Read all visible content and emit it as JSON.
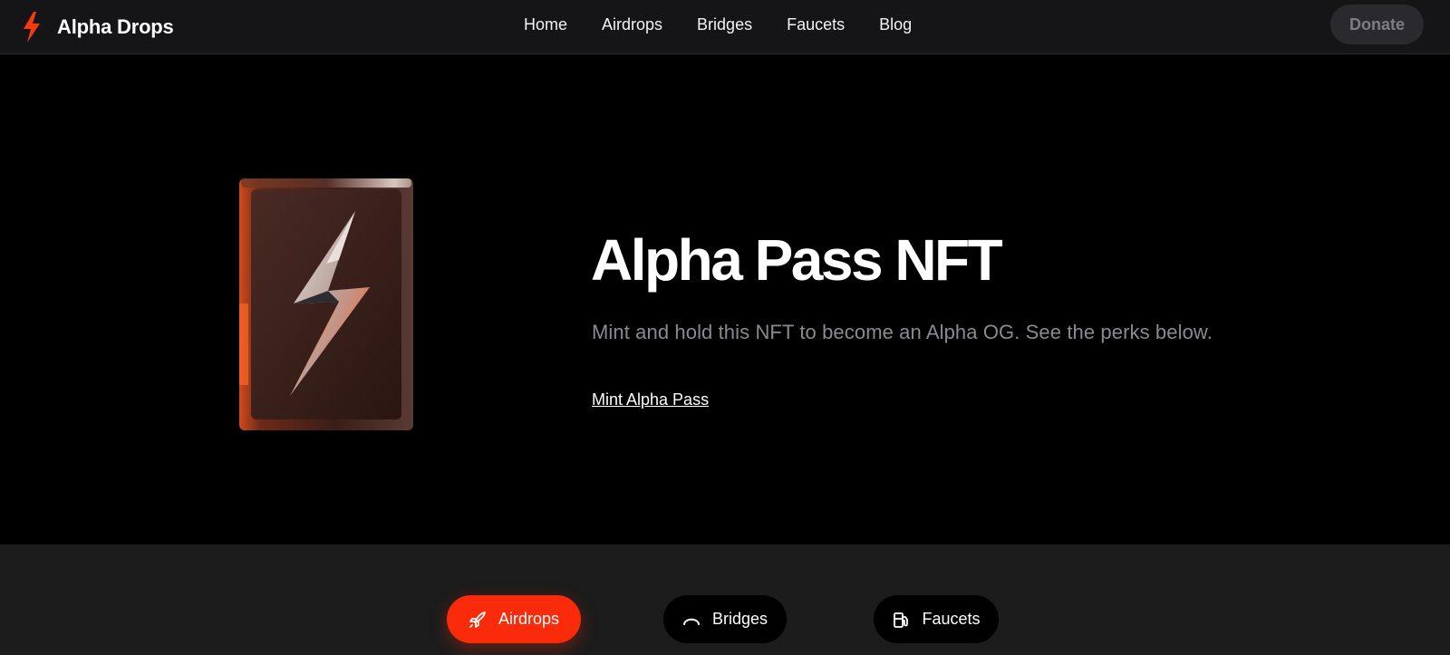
{
  "header": {
    "brand_name": "Alpha Drops",
    "nav": [
      "Home",
      "Airdrops",
      "Bridges",
      "Faucets",
      "Blog"
    ],
    "donate_label": "Donate"
  },
  "hero": {
    "title": "Alpha Pass NFT",
    "subtitle": "Mint and hold this NFT to become an Alpha OG. See the perks below.",
    "cta_label": "Mint Alpha Pass",
    "image_icon": "lightning-card-icon"
  },
  "tabs": [
    {
      "label": "Airdrops",
      "icon": "rocket-icon",
      "active": true
    },
    {
      "label": "Bridges",
      "icon": "bridge-arc-icon",
      "active": false
    },
    {
      "label": "Faucets",
      "icon": "fuel-pump-icon",
      "active": false
    }
  ],
  "colors": {
    "accent": "#fa2b0a",
    "header_bg": "#151517",
    "hero_bg": "#000000",
    "band_bg": "#1c1c1c",
    "muted_text": "#8a8a90"
  }
}
